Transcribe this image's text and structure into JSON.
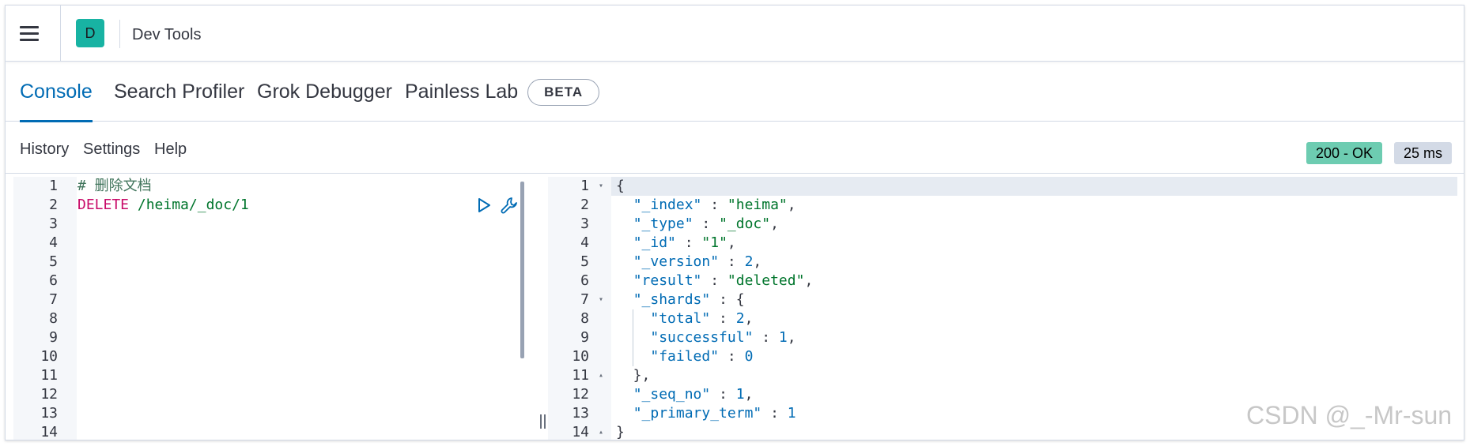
{
  "header": {
    "avatar_letter": "D",
    "app_title": "Dev Tools"
  },
  "tabs": [
    {
      "label": "Console"
    },
    {
      "label": "Search Profiler"
    },
    {
      "label": "Grok Debugger"
    },
    {
      "label": "Painless Lab",
      "badge": "BETA"
    }
  ],
  "submenu": {
    "history": "History",
    "settings": "Settings",
    "help": "Help"
  },
  "response": {
    "status": "200 - OK",
    "time": "25 ms"
  },
  "request_editor": {
    "line_numbers": [
      "1",
      "2",
      "3",
      "4",
      "5",
      "6",
      "7",
      "8",
      "9",
      "10",
      "11",
      "12",
      "13",
      "14"
    ],
    "comment": "# 删除文档",
    "method": "DELETE",
    "path": "/heima/_doc/1"
  },
  "response_editor": {
    "line_numbers": [
      "1",
      "2",
      "3",
      "4",
      "5",
      "6",
      "7",
      "8",
      "9",
      "10",
      "11",
      "12",
      "13",
      "14"
    ],
    "lines": [
      [
        {
          "t": "{",
          "c": "punc"
        }
      ],
      [
        {
          "t": "  ",
          "c": "punc"
        },
        {
          "t": "\"_index\"",
          "c": "key"
        },
        {
          "t": " : ",
          "c": "punc"
        },
        {
          "t": "\"heima\"",
          "c": "str"
        },
        {
          "t": ",",
          "c": "punc"
        }
      ],
      [
        {
          "t": "  ",
          "c": "punc"
        },
        {
          "t": "\"_type\"",
          "c": "key"
        },
        {
          "t": " : ",
          "c": "punc"
        },
        {
          "t": "\"_doc\"",
          "c": "str"
        },
        {
          "t": ",",
          "c": "punc"
        }
      ],
      [
        {
          "t": "  ",
          "c": "punc"
        },
        {
          "t": "\"_id\"",
          "c": "key"
        },
        {
          "t": " : ",
          "c": "punc"
        },
        {
          "t": "\"1\"",
          "c": "str"
        },
        {
          "t": ",",
          "c": "punc"
        }
      ],
      [
        {
          "t": "  ",
          "c": "punc"
        },
        {
          "t": "\"_version\"",
          "c": "key"
        },
        {
          "t": " : ",
          "c": "punc"
        },
        {
          "t": "2",
          "c": "num"
        },
        {
          "t": ",",
          "c": "punc"
        }
      ],
      [
        {
          "t": "  ",
          "c": "punc"
        },
        {
          "t": "\"result\"",
          "c": "key"
        },
        {
          "t": " : ",
          "c": "punc"
        },
        {
          "t": "\"deleted\"",
          "c": "str"
        },
        {
          "t": ",",
          "c": "punc"
        }
      ],
      [
        {
          "t": "  ",
          "c": "punc"
        },
        {
          "t": "\"_shards\"",
          "c": "key"
        },
        {
          "t": " : {",
          "c": "punc"
        }
      ],
      [
        {
          "t": "    ",
          "c": "punc"
        },
        {
          "t": "\"total\"",
          "c": "key"
        },
        {
          "t": " : ",
          "c": "punc"
        },
        {
          "t": "2",
          "c": "num"
        },
        {
          "t": ",",
          "c": "punc"
        }
      ],
      [
        {
          "t": "    ",
          "c": "punc"
        },
        {
          "t": "\"successful\"",
          "c": "key"
        },
        {
          "t": " : ",
          "c": "punc"
        },
        {
          "t": "1",
          "c": "num"
        },
        {
          "t": ",",
          "c": "punc"
        }
      ],
      [
        {
          "t": "    ",
          "c": "punc"
        },
        {
          "t": "\"failed\"",
          "c": "key"
        },
        {
          "t": " : ",
          "c": "punc"
        },
        {
          "t": "0",
          "c": "num"
        }
      ],
      [
        {
          "t": "  },",
          "c": "punc"
        }
      ],
      [
        {
          "t": "  ",
          "c": "punc"
        },
        {
          "t": "\"_seq_no\"",
          "c": "key"
        },
        {
          "t": " : ",
          "c": "punc"
        },
        {
          "t": "1",
          "c": "num"
        },
        {
          "t": ",",
          "c": "punc"
        }
      ],
      [
        {
          "t": "  ",
          "c": "punc"
        },
        {
          "t": "\"_primary_term\"",
          "c": "key"
        },
        {
          "t": " : ",
          "c": "punc"
        },
        {
          "t": "1",
          "c": "num"
        }
      ],
      [
        {
          "t": "}",
          "c": "punc"
        }
      ]
    ],
    "fold_markers": {
      "1": "▾",
      "7": "▾",
      "11": "▴",
      "14": "▴"
    }
  },
  "watermark": "CSDN @_-Mr-sun",
  "icons": {
    "menu": "hamburger-icon",
    "run": "play-icon",
    "settings": "wrench-icon"
  },
  "colors": {
    "accent": "#006bb4",
    "status_ok": "#6dccb1",
    "avatar": "#18b3a3",
    "method": "#c80a68",
    "string": "#00752c"
  }
}
